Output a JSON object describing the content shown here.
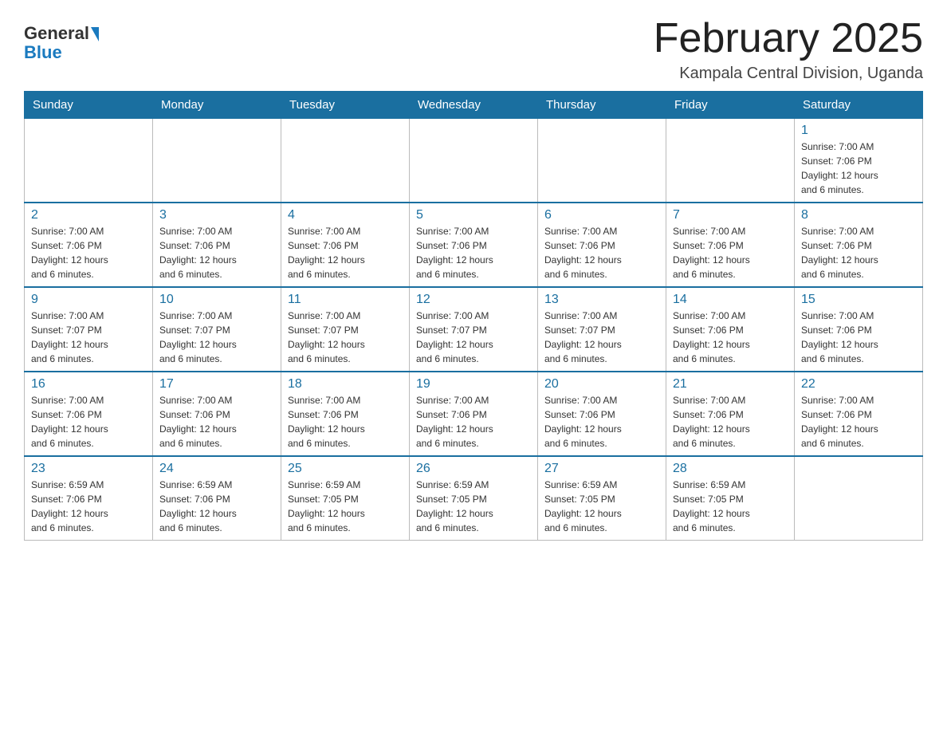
{
  "header": {
    "logo_general": "General",
    "logo_blue": "Blue",
    "month_title": "February 2025",
    "location": "Kampala Central Division, Uganda"
  },
  "weekdays": [
    "Sunday",
    "Monday",
    "Tuesday",
    "Wednesday",
    "Thursday",
    "Friday",
    "Saturday"
  ],
  "weeks": [
    {
      "days": [
        {
          "num": "",
          "info": ""
        },
        {
          "num": "",
          "info": ""
        },
        {
          "num": "",
          "info": ""
        },
        {
          "num": "",
          "info": ""
        },
        {
          "num": "",
          "info": ""
        },
        {
          "num": "",
          "info": ""
        },
        {
          "num": "1",
          "info": "Sunrise: 7:00 AM\nSunset: 7:06 PM\nDaylight: 12 hours\nand 6 minutes."
        }
      ]
    },
    {
      "days": [
        {
          "num": "2",
          "info": "Sunrise: 7:00 AM\nSunset: 7:06 PM\nDaylight: 12 hours\nand 6 minutes."
        },
        {
          "num": "3",
          "info": "Sunrise: 7:00 AM\nSunset: 7:06 PM\nDaylight: 12 hours\nand 6 minutes."
        },
        {
          "num": "4",
          "info": "Sunrise: 7:00 AM\nSunset: 7:06 PM\nDaylight: 12 hours\nand 6 minutes."
        },
        {
          "num": "5",
          "info": "Sunrise: 7:00 AM\nSunset: 7:06 PM\nDaylight: 12 hours\nand 6 minutes."
        },
        {
          "num": "6",
          "info": "Sunrise: 7:00 AM\nSunset: 7:06 PM\nDaylight: 12 hours\nand 6 minutes."
        },
        {
          "num": "7",
          "info": "Sunrise: 7:00 AM\nSunset: 7:06 PM\nDaylight: 12 hours\nand 6 minutes."
        },
        {
          "num": "8",
          "info": "Sunrise: 7:00 AM\nSunset: 7:06 PM\nDaylight: 12 hours\nand 6 minutes."
        }
      ]
    },
    {
      "days": [
        {
          "num": "9",
          "info": "Sunrise: 7:00 AM\nSunset: 7:07 PM\nDaylight: 12 hours\nand 6 minutes."
        },
        {
          "num": "10",
          "info": "Sunrise: 7:00 AM\nSunset: 7:07 PM\nDaylight: 12 hours\nand 6 minutes."
        },
        {
          "num": "11",
          "info": "Sunrise: 7:00 AM\nSunset: 7:07 PM\nDaylight: 12 hours\nand 6 minutes."
        },
        {
          "num": "12",
          "info": "Sunrise: 7:00 AM\nSunset: 7:07 PM\nDaylight: 12 hours\nand 6 minutes."
        },
        {
          "num": "13",
          "info": "Sunrise: 7:00 AM\nSunset: 7:07 PM\nDaylight: 12 hours\nand 6 minutes."
        },
        {
          "num": "14",
          "info": "Sunrise: 7:00 AM\nSunset: 7:06 PM\nDaylight: 12 hours\nand 6 minutes."
        },
        {
          "num": "15",
          "info": "Sunrise: 7:00 AM\nSunset: 7:06 PM\nDaylight: 12 hours\nand 6 minutes."
        }
      ]
    },
    {
      "days": [
        {
          "num": "16",
          "info": "Sunrise: 7:00 AM\nSunset: 7:06 PM\nDaylight: 12 hours\nand 6 minutes."
        },
        {
          "num": "17",
          "info": "Sunrise: 7:00 AM\nSunset: 7:06 PM\nDaylight: 12 hours\nand 6 minutes."
        },
        {
          "num": "18",
          "info": "Sunrise: 7:00 AM\nSunset: 7:06 PM\nDaylight: 12 hours\nand 6 minutes."
        },
        {
          "num": "19",
          "info": "Sunrise: 7:00 AM\nSunset: 7:06 PM\nDaylight: 12 hours\nand 6 minutes."
        },
        {
          "num": "20",
          "info": "Sunrise: 7:00 AM\nSunset: 7:06 PM\nDaylight: 12 hours\nand 6 minutes."
        },
        {
          "num": "21",
          "info": "Sunrise: 7:00 AM\nSunset: 7:06 PM\nDaylight: 12 hours\nand 6 minutes."
        },
        {
          "num": "22",
          "info": "Sunrise: 7:00 AM\nSunset: 7:06 PM\nDaylight: 12 hours\nand 6 minutes."
        }
      ]
    },
    {
      "days": [
        {
          "num": "23",
          "info": "Sunrise: 6:59 AM\nSunset: 7:06 PM\nDaylight: 12 hours\nand 6 minutes."
        },
        {
          "num": "24",
          "info": "Sunrise: 6:59 AM\nSunset: 7:06 PM\nDaylight: 12 hours\nand 6 minutes."
        },
        {
          "num": "25",
          "info": "Sunrise: 6:59 AM\nSunset: 7:05 PM\nDaylight: 12 hours\nand 6 minutes."
        },
        {
          "num": "26",
          "info": "Sunrise: 6:59 AM\nSunset: 7:05 PM\nDaylight: 12 hours\nand 6 minutes."
        },
        {
          "num": "27",
          "info": "Sunrise: 6:59 AM\nSunset: 7:05 PM\nDaylight: 12 hours\nand 6 minutes."
        },
        {
          "num": "28",
          "info": "Sunrise: 6:59 AM\nSunset: 7:05 PM\nDaylight: 12 hours\nand 6 minutes."
        },
        {
          "num": "",
          "info": ""
        }
      ]
    }
  ]
}
